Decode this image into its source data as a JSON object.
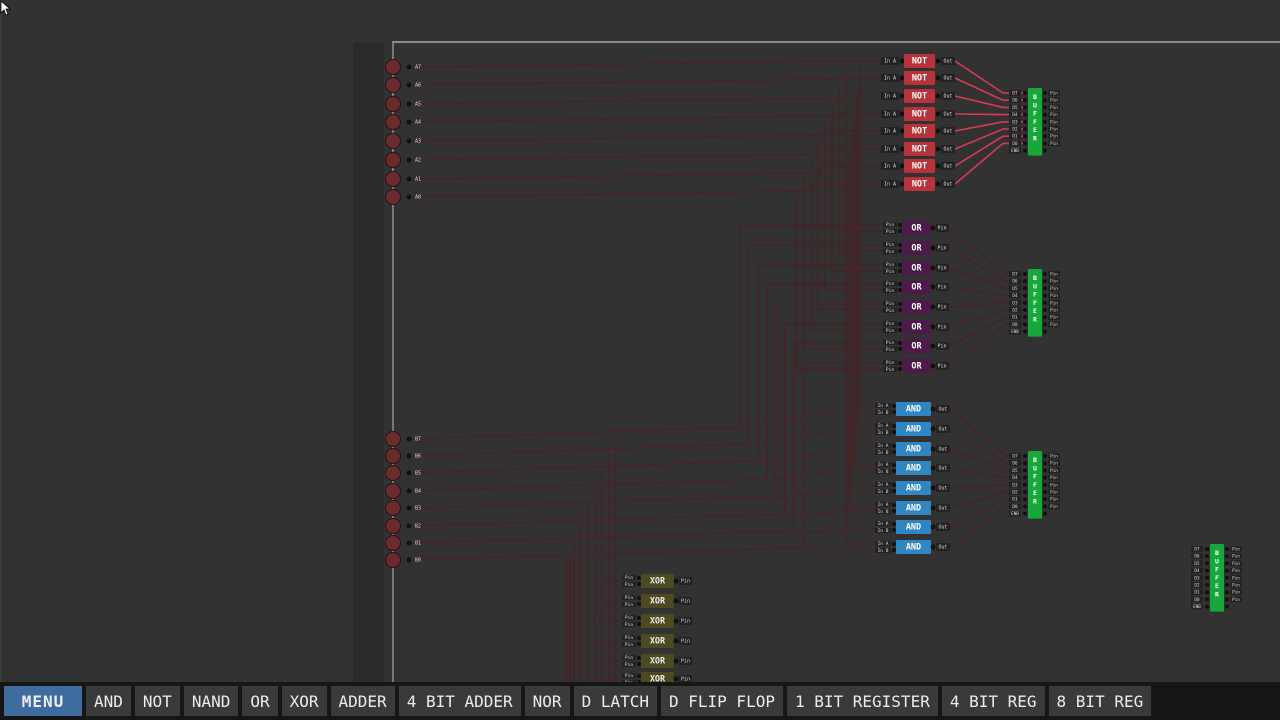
{
  "toolbar": {
    "menu_label": "MENU",
    "items": [
      "AND",
      "NOT",
      "NAND",
      "OR",
      "XOR",
      "ADDER",
      "4 BIT ADDER",
      "NOR",
      "D LATCH",
      "D FLIP FLOP",
      "1 BIT REGISTER",
      "4 BIT REG",
      "8 BIT REG"
    ]
  },
  "circuit": {
    "input_group_a_labels": [
      "A7",
      "A6",
      "A5",
      "A4",
      "A3",
      "A2",
      "A1",
      "A0"
    ],
    "input_group_b_labels": [
      "B7",
      "B6",
      "B5",
      "B4",
      "B3",
      "B2",
      "B1",
      "B0"
    ],
    "not_gate": {
      "label": "NOT",
      "input": "In A",
      "output": "Out",
      "count": 8,
      "color": "#b8323b"
    },
    "or_gate": {
      "label": "OR",
      "input": "Pin",
      "output": "Pin",
      "count": 8,
      "color": "#4d1a4a"
    },
    "and_gate": {
      "label": "AND",
      "input_a": "In A",
      "input_b": "In B",
      "output": "Out",
      "count": 8,
      "color": "#2f86c2"
    },
    "xor_gate": {
      "label": "XOR",
      "input": "Pin",
      "output": "Pin",
      "count": 6,
      "color": "#4d4a22"
    },
    "buffer": {
      "label_letters": [
        "B",
        "U",
        "F",
        "F",
        "E",
        "R"
      ],
      "pins_left": [
        "D7",
        "D6",
        "D5",
        "D4",
        "D3",
        "D2",
        "D1",
        "D0",
        "ENB"
      ],
      "pin_right": "Pin",
      "count": 4,
      "color": "#17a83a"
    },
    "colors": {
      "wire": "#4a2024",
      "active_wire": "#d83a55",
      "input_node": "#6b2a2d",
      "background": "#323232",
      "menu": "#3f6c9e"
    }
  }
}
